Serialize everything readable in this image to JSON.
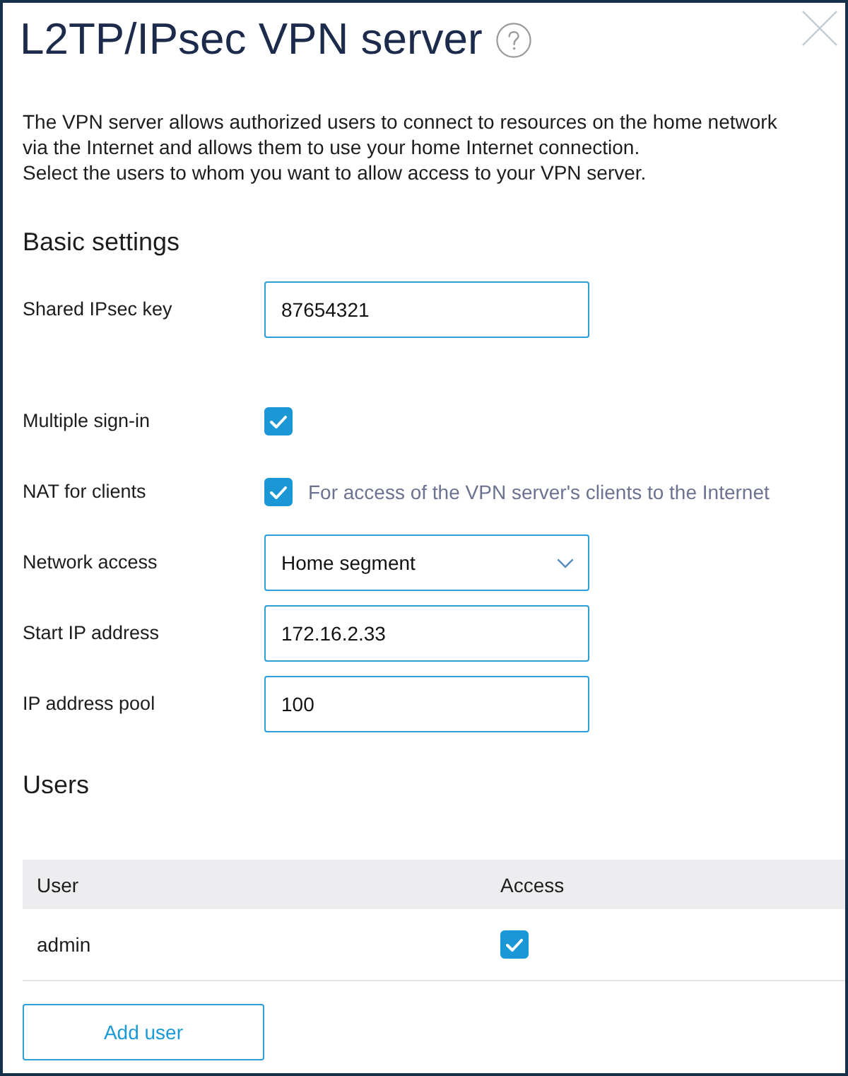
{
  "dialog": {
    "title": "L2TP/IPsec VPN server",
    "description": [
      "The VPN server allows authorized users to connect to resources on the home network via the Internet and allows them to use your home Internet connection.",
      "Select the users to whom you want to allow access to your VPN server."
    ]
  },
  "basic_settings": {
    "heading": "Basic settings",
    "fields": [
      {
        "kind": "text",
        "label": "Shared IPsec key",
        "value": "87654321"
      },
      {
        "kind": "checkbox",
        "label": "Multiple sign-in",
        "checked": true
      },
      {
        "kind": "checkbox",
        "label": "NAT for clients",
        "checked": true,
        "hint": "For access of the VPN server's clients to the Internet"
      },
      {
        "kind": "select",
        "label": "Network access",
        "value": "Home segment"
      },
      {
        "kind": "text",
        "label": "Start IP address",
        "value": "172.16.2.33"
      },
      {
        "kind": "text",
        "label": "IP address pool",
        "value": "100"
      }
    ]
  },
  "users": {
    "heading": "Users",
    "columns": [
      "User",
      "Access"
    ],
    "rows": [
      {
        "user": "admin",
        "checked": true
      }
    ],
    "add_button": "Add user"
  }
}
